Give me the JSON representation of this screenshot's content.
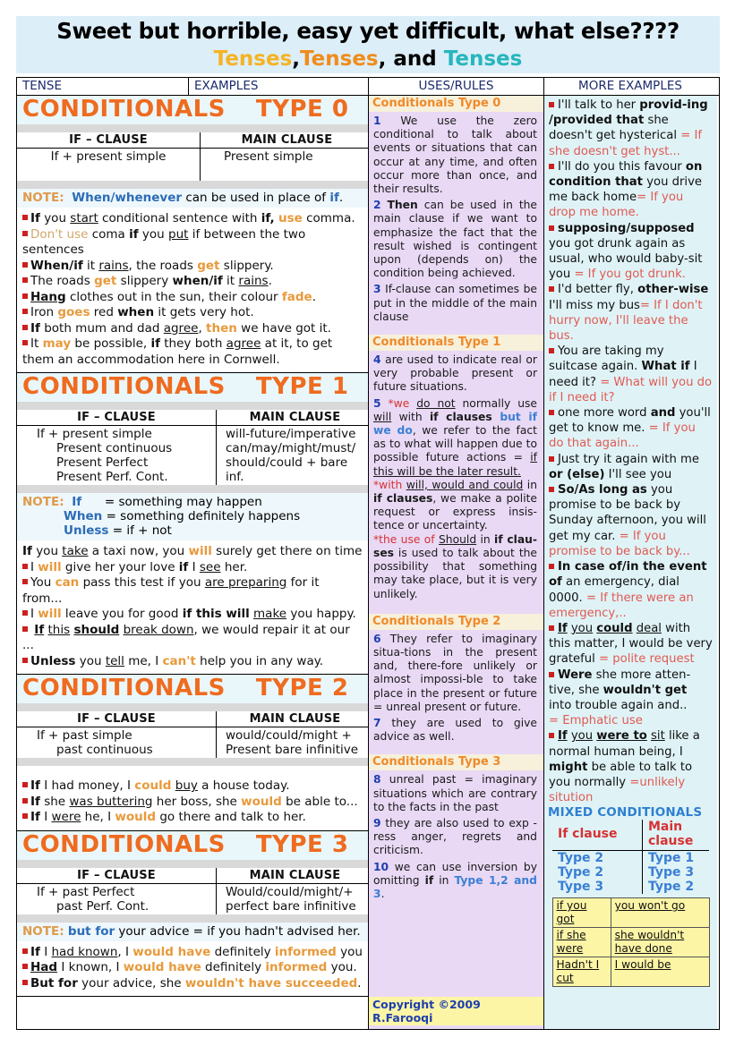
{
  "banner": {
    "line1": "Sweet but horrible, easy yet difficult, what else????",
    "tenses_1": "Tenses",
    "comma_1": ",",
    "tenses_2": "Tenses",
    "and": ", and ",
    "tenses_3": "Tenses"
  },
  "headers": {
    "c1": "TENSE",
    "c2": "EXAMPLES",
    "c3": "USES/RULES",
    "c4": "MORE EXAMPLES"
  },
  "colors": {
    "orange_title": "#ef6b1f",
    "banner_bg": "#dceef8",
    "middle_bg": "#e9d9f5",
    "right_bg": "#dff3f7",
    "bullet_red": "#cc1f1f",
    "highlight_yellow": "#fdf5a6"
  },
  "left": {
    "type0": {
      "title": "CONDITIONALS",
      "type": "TYPE 0",
      "th_if": "IF – CLAUSE",
      "th_main": "MAIN CLAUSE",
      "row_if": "If + present simple",
      "row_main": "Present simple",
      "note_label": "NOTE:",
      "note_blue": "When/whenever",
      "note_rest": " can be used in place of ",
      "note_if": "if",
      "note_dot": ".",
      "ex": [
        "If you start conditional sentence with if, use comma.",
        "Don't use coma if you put if between the two sentences",
        "When/if it rains, the roads get slippery.",
        "The roads get slippery when/if it rains.",
        "Hang clothes out in the sun, their colour fade.",
        "Iron goes red when it gets very hot.",
        "If both mum and dad agree, then we have got it.",
        "It may be possible, if they both agree at it, to get them an accommodation here in Cornwell."
      ]
    },
    "type1": {
      "title": "CONDITIONALS",
      "type": "TYPE 1",
      "th_if": "IF – CLAUSE",
      "th_main": "MAIN CLAUSE",
      "row_if": "If + present simple",
      "row_if2": "Present continuous",
      "row_if3": "Present Perfect",
      "row_if4": "Present Perf. Cont.",
      "row_main": "will-future/imperative",
      "row_main2": "can/may/might/must/",
      "row_main3": "should/could + bare inf.",
      "note_label": "NOTE:",
      "note_l1_k": "If",
      "note_l1_v": "= something may happen",
      "note_l2_k": "When",
      "note_l2_v": "= something definitely happens",
      "note_l3_k": "Unless",
      "note_l3_v": "= if + not",
      "ex": [
        "If you take a taxi now, you will surely get there on time",
        "I will give her your love if I see her.",
        "You can pass this test if you are preparing for it from...",
        "I will leave you for good if this will make you happy.",
        "If this should break down, we would repair it at our ...",
        "Unless you tell me, I can't help you in any way."
      ]
    },
    "type2": {
      "title": "CONDITIONALS",
      "type": "TYPE 2",
      "th_if": "IF – CLAUSE",
      "th_main": "MAIN CLAUSE",
      "row_if": "If + past simple",
      "row_if2": "past continuous",
      "row_main": "would/could/might +",
      "row_main2": "Present bare infinitive",
      "ex": [
        "If I had money, I could buy a house today.",
        "If she was buttering her boss, she would be able to...",
        "If I were he, I would go there and talk to her."
      ]
    },
    "type3": {
      "title": "CONDITIONALS",
      "type": "TYPE 3",
      "th_if": "IF – CLAUSE",
      "th_main": "MAIN CLAUSE",
      "row_if": "If + past Perfect",
      "row_if2": "past Perf. Cont.",
      "row_main": "Would/could/might/+",
      "row_main2": "perfect bare infinitive",
      "note_label": "NOTE:",
      "note_blue": "but for",
      "note_rest": " your advice = if you hadn't advised her.",
      "ex": [
        "If I had known, I would have definitely informed you",
        "Had I known, I would have definitely informed you.",
        "But for your advice, she wouldn't have succeeded."
      ]
    }
  },
  "middle": {
    "s0_title": "Conditionals Type 0",
    "s0_p1_num": "1",
    "s0_p1": "We use the zero conditional to talk about events or situations that can occur at any time, and often occur more than once, and their results.",
    "s0_p2_num": "2",
    "s0_p2_bold": "Then",
    "s0_p2": "can be used in the main clause if we want to emphasize the fact that the result wished is contingent upon (depends on) the condition being achieved.",
    "s0_p3_num": "3",
    "s0_p3": "If-clause can sometimes be put in the middle of the main clause",
    "s1_title": "Conditionals Type 1",
    "s1_p4_num": "4",
    "s1_p4": "are used to indicate real or very probable present or future situations.",
    "s1_p5_num": "5",
    "s1_p5_a": "*we ",
    "s1_p5_u1": "do not",
    "s1_p5_b": " normally use ",
    "s1_p5_u2": "will",
    "s1_p5_c": " with ",
    "s1_p5_bold": "if clauses",
    "s1_p5_blue": " but if we do",
    "s1_p5_d": ", we refer to the fact as to what will happen due to possible future actions = ",
    "s1_p5_u3": "if this will be the later result.",
    "s1_p6_a": "*with ",
    "s1_p6_u1": "will, would and could",
    "s1_p6_b": " in ",
    "s1_p6_bold": "if clauses",
    "s1_p6_c": ", we make a polite request or express insis- tence or uncertainty.",
    "s1_p7_a": "*the use of ",
    "s1_p7_u1": "Should",
    "s1_p7_b": " in ",
    "s1_p7_bold": "if clau-ses",
    "s1_p7_c": " is used to talk about the possibility that something may take place, but it is very unlikely.",
    "s2_title": "Conditionals Type 2",
    "s2_p6_num": "6",
    "s2_p6": "They refer to imaginary situa-tions in the present and, there-fore unlikely or almost impossi-ble to take place in the present or future  = unreal present or future.",
    "s2_p7_num": "7",
    "s2_p7": "they are used to give advice as well.",
    "s3_title": "Conditionals Type 3",
    "s3_p8_num": "8",
    "s3_p8": "unreal past = imaginary situations which are contrary to the facts in the past",
    "s3_p9_num": "9",
    "s3_p9": "they are also used to exp - ress anger, regrets and criticism.",
    "s3_p10_num": "10",
    "s3_p10_a": "we can use inversion by omitting ",
    "s3_p10_bold": "if",
    "s3_p10_b": " in ",
    "s3_p10_blue": "Type 1,2 and 3",
    "s3_p10_c": ".",
    "copyright": "Copyright ©2009 R.Farooqi"
  },
  "right": {
    "examples": [
      {
        "black1": "I'll talk to her ",
        "bold": "provid-ing /provided that",
        "black2": " she doesn't get hysterical ",
        "red": "= If she doesn't get hyst..."
      },
      {
        "black1": "I'll do you this favour ",
        "bold": "on condition that",
        "black2": " you drive me back home",
        "red": "= If you drop me home."
      },
      {
        "black1": "",
        "bold": "supposing/supposed",
        "black2": " you got drunk again as usual, who would baby-sit you ",
        "red": "= If you got drunk."
      },
      {
        "black1": "I'd better fly, ",
        "bold": "other-wise",
        "black2": " I'll miss my bus",
        "red": "= If I don't hurry now, I'll leave the bus."
      },
      {
        "black1": "You are taking my suitcase again. ",
        "bold": "What if",
        "black2": " I need it? ",
        "red": "= What will you do if I need it?"
      },
      {
        "black1": "one more word ",
        "bold": "and",
        "black2": " you'll get to know me. ",
        "red": "= If you do that again..."
      },
      {
        "black1": "Just try it again with me ",
        "bold": "or (else)",
        "black2": " I'll see you",
        "red": ""
      },
      {
        "black1": "",
        "bold": "So/As long as",
        "black2": " you promise to be back by Sunday afternoon, you will get my car. ",
        "red": "= If you promise to be back by..."
      },
      {
        "black1": "",
        "bold": "In case of/in the event of",
        "black2": " an emergency, dial 0000. ",
        "red": "= If there were an emergency,.."
      },
      {
        "black1": "",
        "bold": "If you could deal",
        "black2": " with this matter, I would be very grateful ",
        "red": "= polite request"
      },
      {
        "black1": "",
        "bold": "Were",
        "black2": " she more atten-tive, she ",
        "bold2": "wouldn't get",
        "black3": " into trouble again and..",
        "red": "= Emphatic use"
      },
      {
        "black1": "",
        "bold": "If you were to",
        "black2": " sit like a normal human being, I ",
        "bold2": "might",
        "black3": " be able to talk to you normally ",
        "red": "=unlikely sitution"
      }
    ],
    "mixed_title": "MIXED CONDITIONALS",
    "mixed_th_if": "If clause",
    "mixed_th_main": "Main clause",
    "mixed_rows": [
      {
        "if": "Type 2",
        "main": "Type 1"
      },
      {
        "if": "Type 2",
        "main": "Type 3"
      },
      {
        "if": "Type 3",
        "main": "Type 2"
      }
    ],
    "yellow_rows": [
      {
        "if": "if you got",
        "main": "you won't go"
      },
      {
        "if": "if she were",
        "main": "she wouldn't have done"
      },
      {
        "if": "Hadn't I cut",
        "main": "I would be"
      }
    ]
  }
}
